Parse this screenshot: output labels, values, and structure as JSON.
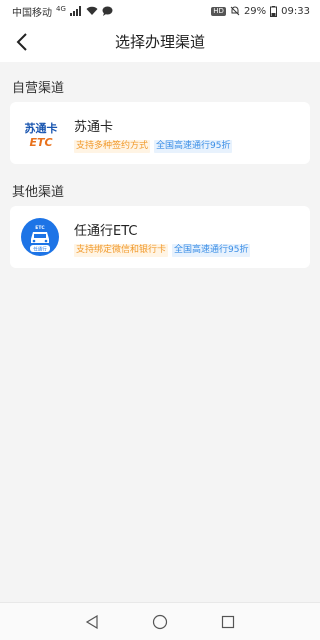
{
  "status_bar": {
    "carrier": "中国移动",
    "signal_label": "4G",
    "battery": "29%",
    "time": "09:33",
    "hd": "HD"
  },
  "header": {
    "title": "选择办理渠道"
  },
  "sections": [
    {
      "title": "自营渠道",
      "items": [
        {
          "name": "苏通卡",
          "logo_text_top": "苏通卡",
          "logo_text_bottom": "ETC",
          "tags": [
            "支持多种签约方式",
            "全国高速通行95折"
          ]
        }
      ]
    },
    {
      "title": "其他渠道",
      "items": [
        {
          "name": "任通行ETC",
          "logo_text_top": "ETC",
          "logo_text_bottom": "任通行",
          "tags": [
            "支持绑定微信和银行卡",
            "全国高速通行95折"
          ]
        }
      ]
    }
  ],
  "colors": {
    "tag_orange": "#f19a2c",
    "tag_blue": "#3a8ee6",
    "sutong_blue": "#1a56b0",
    "sutong_orange": "#e8711c",
    "rentong_blue": "#1d74e6"
  },
  "icons": [
    "back-arrow-icon",
    "signal-icon",
    "wifi-icon",
    "chat-icon",
    "hd-icon",
    "mute-icon",
    "battery-icon",
    "nav-back-icon",
    "nav-home-icon",
    "nav-recent-icon"
  ]
}
